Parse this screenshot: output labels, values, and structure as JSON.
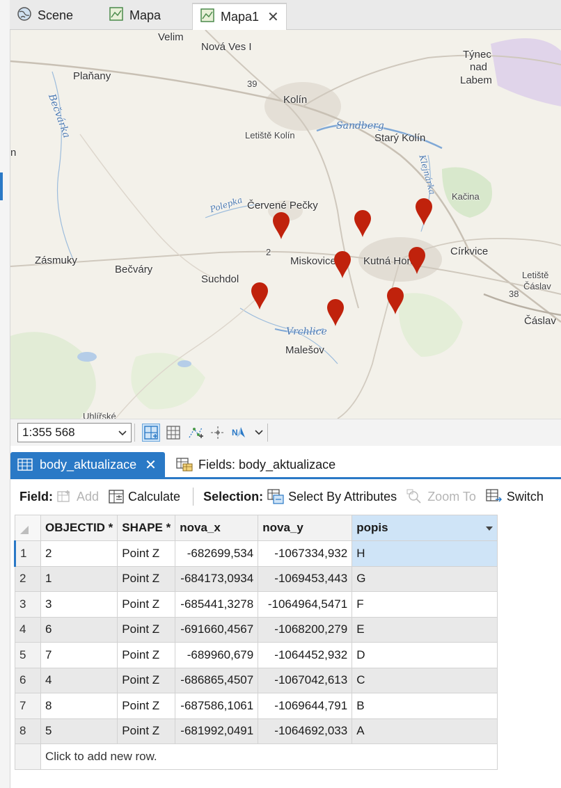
{
  "map_tabs": [
    {
      "label": "Scene",
      "icon": "globe-icon"
    },
    {
      "label": "Mapa",
      "icon": "map-icon"
    },
    {
      "label": "Mapa1",
      "icon": "map-icon",
      "active": true
    }
  ],
  "map_labels": {
    "velim": "Velim",
    "nova_ves": "Nová Ves I",
    "tynec": "Týnec",
    "nad": "nad",
    "labem": "Labem",
    "planany": "Plaňany",
    "becvarka": "Bečvárka",
    "kolin": "Kolín",
    "sandberg": "Sandberg",
    "letiste_kolin": "Letiště Kolín",
    "stary_kolin": "Starý Kolín",
    "klejnarka": "Klejnárka",
    "kacina": "Kačina",
    "polepka": "Polepka",
    "cervene_pecky": "Červené Pečky",
    "n_partial": "n",
    "zasmuky": "Zásmuky",
    "becvary": "Bečváry",
    "miskovice": "Miskovice",
    "kutna_hora": "Kutná Hora",
    "cirkvice": "Církvice",
    "letiste": "Letiště",
    "caslav_small": "Čáslav",
    "suchdol": "Suchdol",
    "vrchlice": "Vrchlice",
    "malesov": "Malešov",
    "caslav": "Čáslav",
    "road_38": "38",
    "road_2": "2",
    "road_39": "39",
    "uhlirske": "Uhlířské"
  },
  "map_toolbar": {
    "scale": "1:355 568"
  },
  "table_tabs": [
    {
      "label": "body_aktualizace",
      "icon": "table-icon",
      "active": true
    },
    {
      "label": "Fields: body_aktualizace",
      "icon": "fields-icon"
    }
  ],
  "table_toolbar": {
    "field_label": "Field:",
    "add": "Add",
    "calculate": "Calculate",
    "selection_label": "Selection:",
    "select_by_attributes": "Select By Attributes",
    "zoom_to": "Zoom To",
    "switch": "Switch"
  },
  "table": {
    "columns": [
      "OBJECTID *",
      "SHAPE *",
      "nova_x",
      "nova_y",
      "popis"
    ],
    "rows": [
      {
        "n": "1",
        "objectid": "2",
        "shape": "Point Z",
        "nova_x": "-682699,534",
        "nova_y": "-1067334,932",
        "popis": "H"
      },
      {
        "n": "2",
        "objectid": "1",
        "shape": "Point Z",
        "nova_x": "-684173,0934",
        "nova_y": "-1069453,443",
        "popis": "G"
      },
      {
        "n": "3",
        "objectid": "3",
        "shape": "Point Z",
        "nova_x": "-685441,3278",
        "nova_y": "-1064964,5471",
        "popis": "F"
      },
      {
        "n": "4",
        "objectid": "6",
        "shape": "Point Z",
        "nova_x": "-691660,4567",
        "nova_y": "-1068200,279",
        "popis": "E"
      },
      {
        "n": "5",
        "objectid": "7",
        "shape": "Point Z",
        "nova_x": "-689960,679",
        "nova_y": "-1064452,932",
        "popis": "D"
      },
      {
        "n": "6",
        "objectid": "4",
        "shape": "Point Z",
        "nova_x": "-686865,4507",
        "nova_y": "-1067042,613",
        "popis": "C"
      },
      {
        "n": "7",
        "objectid": "8",
        "shape": "Point Z",
        "nova_x": "-687586,1061",
        "nova_y": "-1069644,791",
        "popis": "B"
      },
      {
        "n": "8",
        "objectid": "5",
        "shape": "Point Z",
        "nova_x": "-681992,0491",
        "nova_y": "-1064692,033",
        "popis": "A"
      }
    ],
    "add_row": "Click to add new row."
  },
  "colors": {
    "accent": "#2a79c6",
    "pin": "#c0220c",
    "selection": "#cfe4f7"
  }
}
